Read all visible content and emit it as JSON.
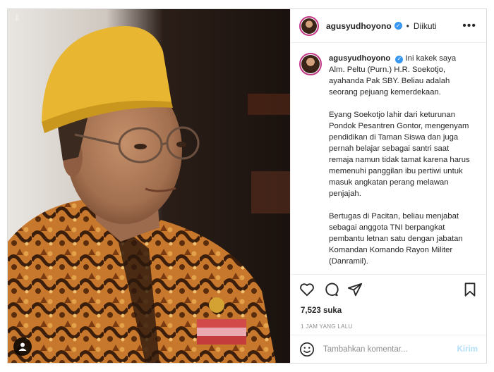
{
  "post": {
    "username": "agusyudhoyono",
    "separator": "•",
    "follow_status": "Diikuti",
    "more_icon": "more-dots-icon",
    "caption_paragraphs": [
      "Ini kakek saya Alm. Peltu (Purn.) H.R. Soekotjo, ayahanda Pak SBY. Beliau adalah seorang pejuang kemerdekaan.",
      "Eyang Soekotjo lahir dari keturunan Pondok Pesantren Gontor, mengenyam pendidikan di Taman Siswa dan juga pernah belajar sebagai santri saat remaja namun tidak tamat karena harus memenuhi panggilan ibu pertiwi untuk masuk angkatan perang melawan penjajah.",
      "Bertugas di Pacitan, beliau menjabat sebagai anggota TNI berpangkat pembantu letnan satu dengan jabatan Komandan Komando Rayon Militer (Danramil)."
    ],
    "likes": "7,523 suka",
    "timestamp": "1 JAM YANG LALU"
  },
  "comment": {
    "placeholder": "Tambahkan komentar...",
    "post_label": "Kirim"
  },
  "colors": {
    "verified": "#3897f0",
    "post_button_disabled": "#b2dffc",
    "story_ring": "#c13584"
  }
}
